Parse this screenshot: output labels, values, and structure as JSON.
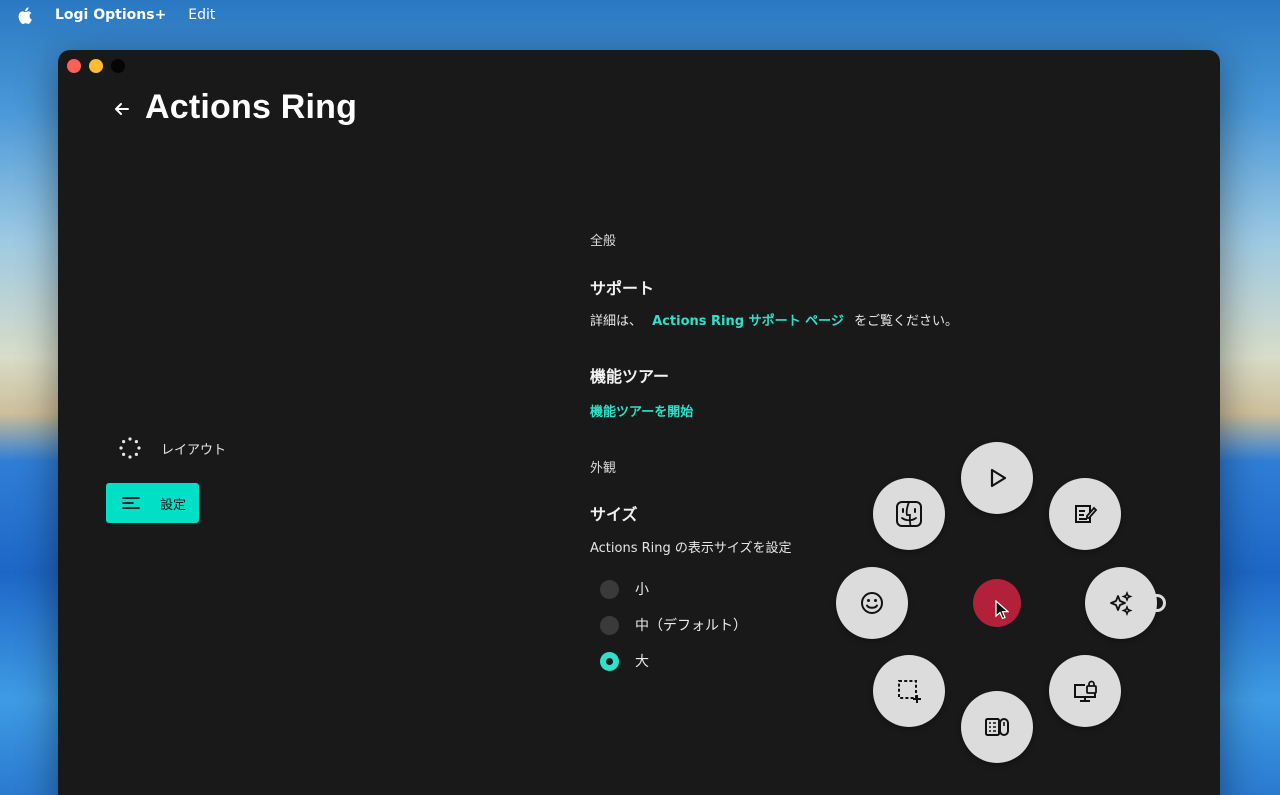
{
  "menubar": {
    "apple_icon": "apple-icon",
    "app_name": "Logi Options+",
    "menu_edit": "Edit"
  },
  "window": {
    "title": "Actions Ring",
    "back_icon": "arrow-left-icon"
  },
  "nav": {
    "layout_label": "レイアウト",
    "settings_label": "設定",
    "accent": "#00e0c6"
  },
  "content": {
    "general_heading": "全般",
    "support": {
      "heading": "サポート",
      "text_before": "詳細は、",
      "link": "Actions Ring サポート ページ",
      "text_after": "をご覧ください。"
    },
    "tour": {
      "heading": "機能ツアー",
      "link": "機能ツアーを開始"
    },
    "appearance_heading": "外観",
    "size": {
      "heading": "サイズ",
      "description": "Actions Ring の表示サイズを設定",
      "options": [
        "小",
        "中（デフォルト）",
        "大"
      ],
      "selected": "大"
    }
  },
  "ring": {
    "buttons": [
      "play-icon",
      "notes-icon",
      "ai-sparkle-icon",
      "screen-lock-icon",
      "keyboard-mouse-icon",
      "screenshot-icon",
      "emoji-icon",
      "finder-icon"
    ],
    "center_color": "#b3203a"
  }
}
